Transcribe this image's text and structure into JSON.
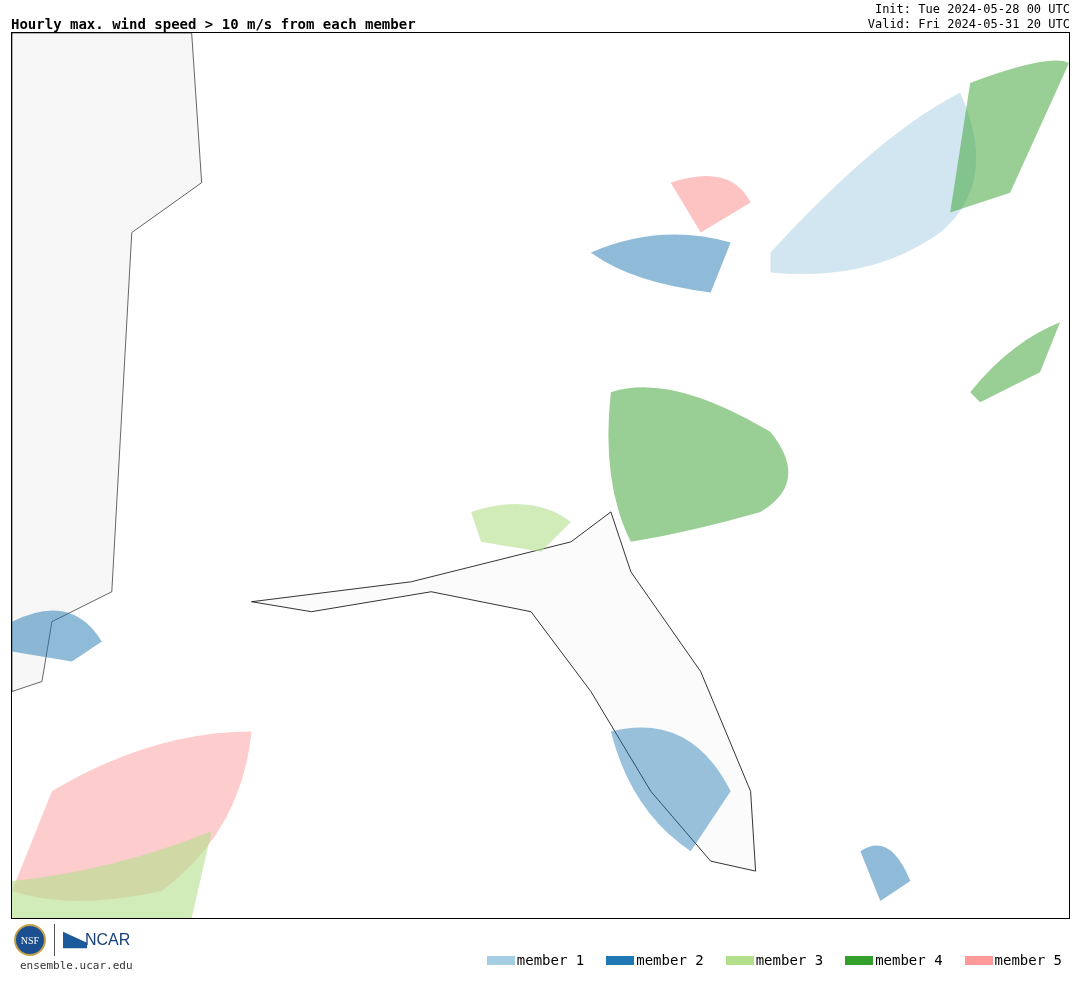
{
  "title": "Hourly max. wind speed > 10 m/s from each member",
  "init": "Init: Tue 2024-05-28 00 UTC",
  "valid": "Valid: Fri 2024-05-31 20 UTC",
  "logos": {
    "nsf": "NSF",
    "ncar": "NCAR",
    "url": "ensemble.ucar.edu"
  },
  "legend": [
    {
      "label": "member 1",
      "color": "#a6cee3"
    },
    {
      "label": "member 2",
      "color": "#1f78b4"
    },
    {
      "label": "member 3",
      "color": "#b2df8a"
    },
    {
      "label": "member 4",
      "color": "#33a02c"
    },
    {
      "label": "member 5",
      "color": "#fb9a99"
    }
  ]
}
